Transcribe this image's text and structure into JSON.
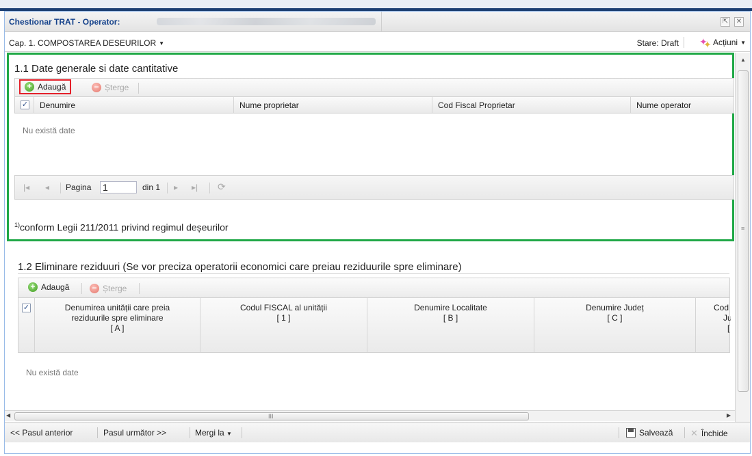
{
  "window": {
    "title": "Chestionar TRAT - Operator:",
    "buttons": {
      "collapse": "⇱",
      "close": "✕"
    }
  },
  "capbar": {
    "chapter": "Cap. 1. COMPOSTAREA DESEURILOR",
    "caret": "▼",
    "status": "Stare: Draft",
    "actions": "Acțiuni"
  },
  "section1": {
    "title": "1.1 Date generale si date cantitative",
    "toolbar": {
      "add": "Adaugă",
      "delete": "Șterge"
    },
    "columns": [
      "Denumire",
      "Nume proprietar",
      "Cod Fiscal Proprietar",
      "Nume operator"
    ],
    "empty": "Nu există date",
    "pager": {
      "page_label": "Pagina",
      "page": "1",
      "of": "din 1"
    },
    "footnote_mark": "1)",
    "footnote": "conform Legii 211/2011 privind regimul deșeurilor"
  },
  "section2": {
    "title": "1.2 Eliminare reziduuri (Se vor preciza operatorii economici care preiau reziduurile spre eliminare)",
    "toolbar": {
      "add": "Adaugă",
      "delete": "Șterge"
    },
    "columns": [
      {
        "l1": "Denumirea unității care preia",
        "l2": "reziduurile spre eliminare",
        "l3": "[ A ]"
      },
      {
        "l1": "Codul FISCAL al unității",
        "l2": "[ 1 ]",
        "l3": ""
      },
      {
        "l1": "Denumire Localitate",
        "l2": "[ B ]",
        "l3": ""
      },
      {
        "l1": "Denumire Județ",
        "l2": "[ C ]",
        "l3": ""
      },
      {
        "l1": "Cod S",
        "l2": "Ju",
        "l3": "["
      }
    ],
    "empty": "Nu există date"
  },
  "footer": {
    "prev": "<< Pasul anterior",
    "next": "Pasul următor >>",
    "goto": "Mergi la",
    "save": "Salvează",
    "close": "Închide"
  },
  "colors": {
    "accent_green": "#1fa846",
    "highlight_red": "#e4202a",
    "title_blue": "#15428b",
    "top_bar": "#1c3f73"
  }
}
